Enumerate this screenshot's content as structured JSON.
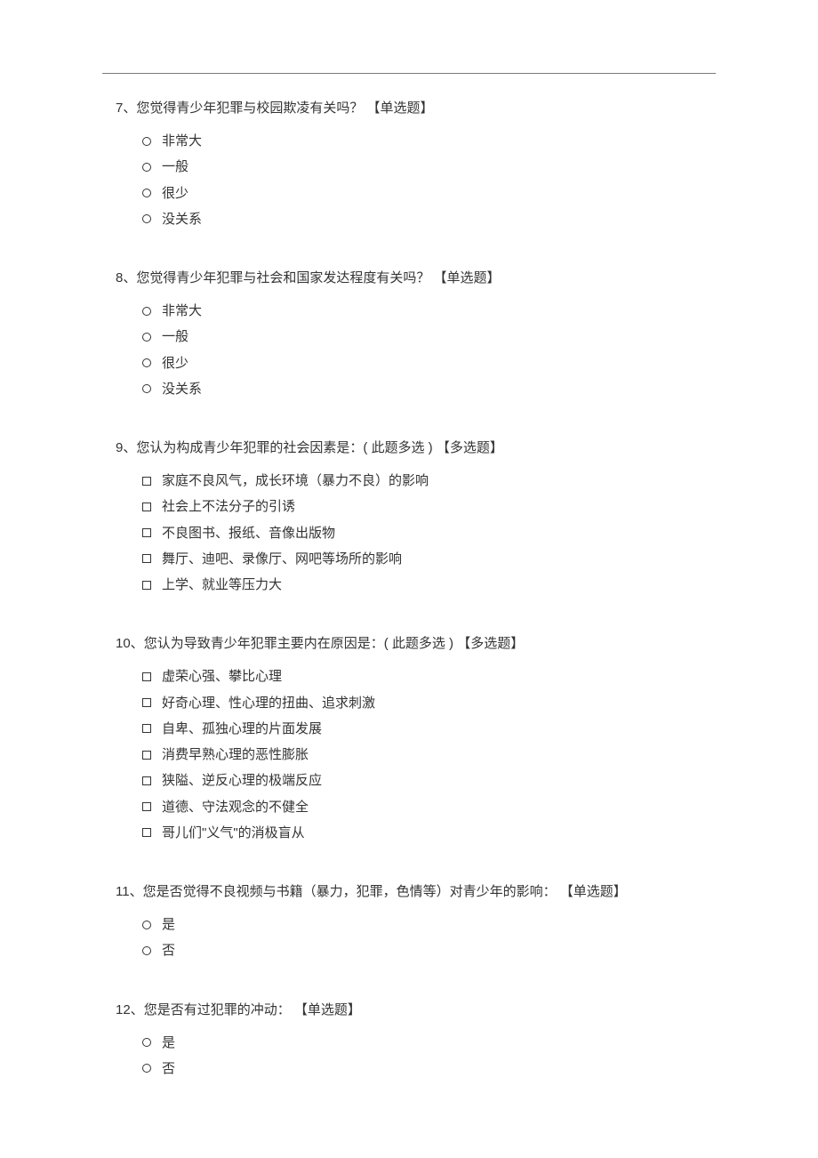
{
  "questions": [
    {
      "number": "7、",
      "text": "您觉得青少年犯罪与校园欺凌有关吗？",
      "tag": "【单选题】",
      "type": "radio",
      "options": [
        "非常大",
        "一般",
        "很少",
        "没关系"
      ]
    },
    {
      "number": "8、",
      "text": "您觉得青少年犯罪与社会和国家发达程度有关吗？",
      "tag": "【单选题】",
      "type": "radio",
      "options": [
        "非常大",
        "一般",
        "很少",
        "没关系"
      ]
    },
    {
      "number": "9、",
      "text": "您认为构成青少年犯罪的社会因素是：( 此题多选 )",
      "tag": "【多选题】",
      "type": "checkbox",
      "options": [
        "家庭不良风气，成长环境（暴力不良）的影响",
        "社会上不法分子的引诱",
        "不良图书、报纸、音像出版物",
        "舞厅、迪吧、录像厅、网吧等场所的影响",
        "上学、就业等压力大"
      ]
    },
    {
      "number": "10、",
      "text": "您认为导致青少年犯罪主要内在原因是：( 此题多选 )",
      "tag": "【多选题】",
      "type": "checkbox",
      "options": [
        "虚荣心强、攀比心理",
        "好奇心理、性心理的扭曲、追求刺激",
        "自卑、孤独心理的片面发展",
        "消费早熟心理的恶性膨胀",
        "狭隘、逆反心理的极端反应",
        "道德、守法观念的不健全",
        "哥儿们\"义气\"的消极盲从"
      ]
    },
    {
      "number": "11、",
      "text": "您是否觉得不良视频与书籍（暴力，犯罪，色情等）对青少年的影响：",
      "tag": "【单选题】",
      "type": "radio",
      "options": [
        "是",
        "否"
      ]
    },
    {
      "number": "12、",
      "text": "您是否有过犯罪的冲动：",
      "tag": "【单选题】",
      "type": "radio",
      "options": [
        "是",
        "否"
      ]
    }
  ]
}
